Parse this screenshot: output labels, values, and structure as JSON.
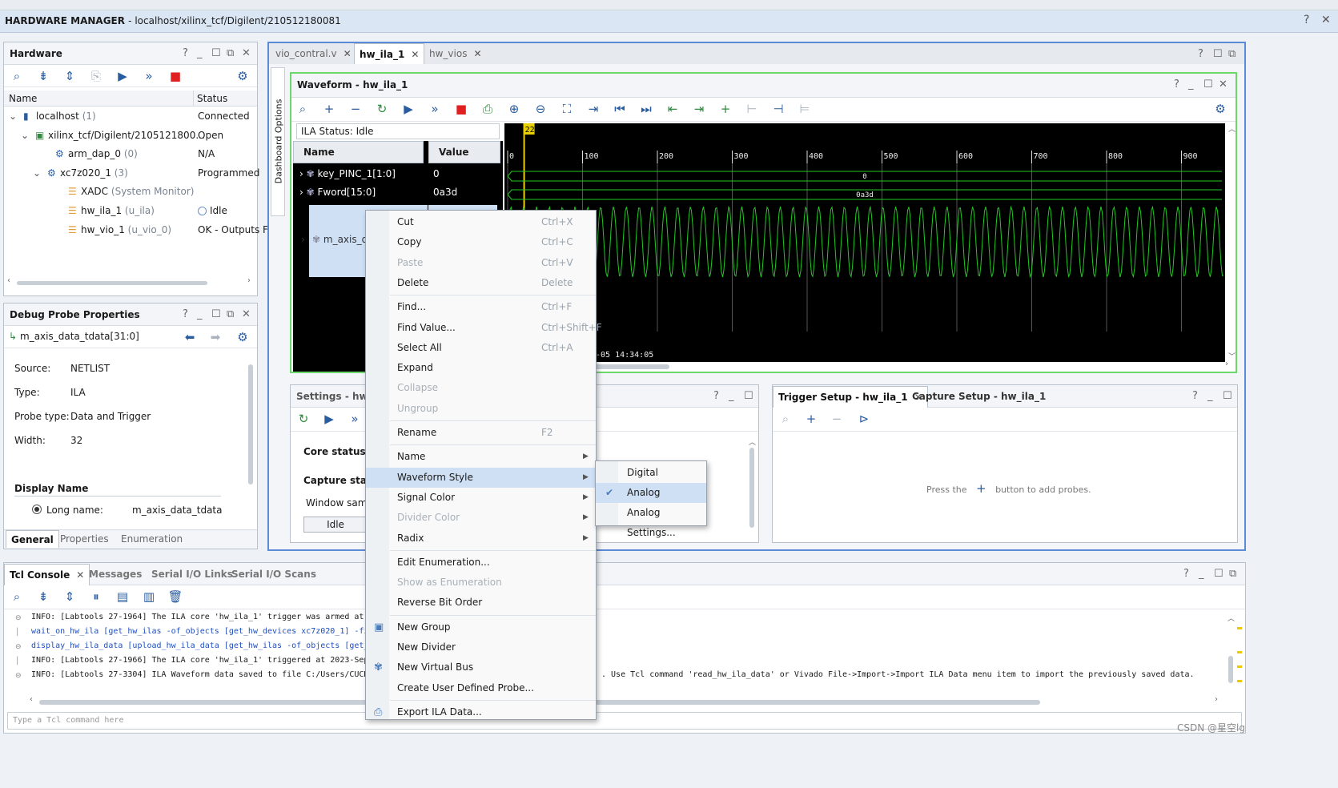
{
  "app": {
    "title": "HARDWARE MANAGER",
    "target": "- localhost/xilinx_tcf/Digilent/210512180081"
  },
  "hardware": {
    "title": "Hardware",
    "col_name": "Name",
    "col_status": "Status",
    "rows": [
      {
        "name": "localhost",
        "suffix": "(1)",
        "status": "Connected"
      },
      {
        "name": "xilinx_tcf/Digilent/2105121800...",
        "suffix": "",
        "status": "Open"
      },
      {
        "name": "arm_dap_0",
        "suffix": "(0)",
        "status": "N/A"
      },
      {
        "name": "xc7z020_1",
        "suffix": "(3)",
        "status": "Programmed"
      },
      {
        "name": "XADC",
        "suffix": "(System Monitor)",
        "status": ""
      },
      {
        "name": "hw_ila_1",
        "suffix": "(u_ila)",
        "status": "Idle"
      },
      {
        "name": "hw_vio_1",
        "suffix": "(u_vio_0)",
        "status": "OK - Outputs F"
      }
    ]
  },
  "probe_props": {
    "title": "Debug Probe Properties",
    "probe": "m_axis_data_tdata[31:0]",
    "source_lbl": "Source:",
    "source": "NETLIST",
    "type_lbl": "Type:",
    "type": "ILA",
    "ptype_lbl": "Probe type:",
    "ptype": "Data and Trigger",
    "width_lbl": "Width:",
    "width": "32",
    "display_name": "Display Name",
    "long_name_lbl": "Long name:",
    "long_name": "m_axis_data_tdata",
    "tabs": [
      "General",
      "Properties",
      "Enumeration"
    ]
  },
  "editor_tabs": [
    "vio_contral.v",
    "hw_ila_1",
    "hw_vios"
  ],
  "dashboard_options": "Dashboard Options",
  "waveform": {
    "title": "Waveform - hw_ila_1",
    "ila_status": "ILA Status:  Idle",
    "col_name": "Name",
    "col_value": "Value",
    "marker": "22",
    "signals": [
      {
        "name": "key_PINC_1[1:0]",
        "value": "0",
        "wave_text": "0"
      },
      {
        "name": "Fword[15:0]",
        "value": "0a3d",
        "wave_text": "0a3d"
      },
      {
        "name": "m_axis_da",
        "value": "",
        "wave_text": ""
      }
    ],
    "ticks": [
      "0",
      "100",
      "200",
      "300",
      "400",
      "500",
      "600",
      "700",
      "800",
      "900"
    ],
    "timestamp": "-05 14:34:05"
  },
  "settings": {
    "title": "Settings - hw_ila",
    "core_status": "Core status",
    "capture_status": "Capture status",
    "window_samp": "Window samp",
    "idle": "Idle"
  },
  "trigger": {
    "tab1": "Trigger Setup - hw_ila_1",
    "tab2": "Capture Setup - hw_ila_1",
    "press": "Press the",
    "add": "button to add probes."
  },
  "console": {
    "tabs": [
      "Tcl Console",
      "Messages",
      "Serial I/O Links",
      "Serial I/O Scans"
    ],
    "lines": [
      {
        "text": "INFO: [Labtools 27-1964] The ILA core 'hw_ila_1' trigger was armed at 2023-",
        "blue": false
      },
      {
        "text": "wait_on_hw_ila [get_hw_ilas -of_objects [get_hw_devices xc7z020_1] -filter",
        "blue": true
      },
      {
        "text": "display_hw_ila_data [upload_hw_ila_data [get_hw_ilas -of_objects [get_hw_de",
        "blue": true
      },
      {
        "text": "INFO: [Labtools 27-1966] The ILA core 'hw_ila_1' triggered at 2023-Sep-05 1",
        "blue": false
      },
      {
        "text": "INFO: [Labtools 27-3304] ILA Waveform data saved to file C:/Users/CUCHF/Des",
        "blue": false
      }
    ],
    "line_tail": ". Use Tcl command 'read_hw_ila_data' or Vivado File->Import->Import ILA Data menu item to import the previously saved data.",
    "placeholder": "Type a Tcl command here"
  },
  "context_menu": {
    "items": [
      {
        "label": "Cut",
        "shortcut": "Ctrl+X",
        "disabled": false,
        "submenu": false
      },
      {
        "label": "Copy",
        "shortcut": "Ctrl+C",
        "disabled": false,
        "submenu": false
      },
      {
        "label": "Paste",
        "shortcut": "Ctrl+V",
        "disabled": true,
        "submenu": false
      },
      {
        "label": "Delete",
        "shortcut": "Delete",
        "disabled": false,
        "submenu": false
      },
      {
        "label": "Find...",
        "shortcut": "Ctrl+F",
        "disabled": false,
        "submenu": false
      },
      {
        "label": "Find Value...",
        "shortcut": "Ctrl+Shift+F",
        "disabled": false,
        "submenu": false
      },
      {
        "label": "Select All",
        "shortcut": "Ctrl+A",
        "disabled": false,
        "submenu": false
      },
      {
        "label": "Expand",
        "shortcut": "",
        "disabled": false,
        "submenu": false
      },
      {
        "label": "Collapse",
        "shortcut": "",
        "disabled": true,
        "submenu": false
      },
      {
        "label": "Ungroup",
        "shortcut": "",
        "disabled": true,
        "submenu": false
      },
      {
        "label": "Rename",
        "shortcut": "F2",
        "disabled": false,
        "submenu": false
      },
      {
        "label": "Name",
        "shortcut": "",
        "disabled": false,
        "submenu": true
      },
      {
        "label": "Waveform Style",
        "shortcut": "",
        "disabled": false,
        "submenu": true
      },
      {
        "label": "Signal Color",
        "shortcut": "",
        "disabled": false,
        "submenu": true
      },
      {
        "label": "Divider Color",
        "shortcut": "",
        "disabled": true,
        "submenu": true
      },
      {
        "label": "Radix",
        "shortcut": "",
        "disabled": false,
        "submenu": true
      },
      {
        "label": "Edit Enumeration...",
        "shortcut": "",
        "disabled": false,
        "submenu": false
      },
      {
        "label": "Show as Enumeration",
        "shortcut": "",
        "disabled": true,
        "submenu": false
      },
      {
        "label": "Reverse Bit Order",
        "shortcut": "",
        "disabled": false,
        "submenu": false
      },
      {
        "label": "New Group",
        "shortcut": "",
        "disabled": false,
        "submenu": false
      },
      {
        "label": "New Divider",
        "shortcut": "",
        "disabled": false,
        "submenu": false
      },
      {
        "label": "New Virtual Bus",
        "shortcut": "",
        "disabled": false,
        "submenu": false
      },
      {
        "label": "Create User Defined Probe...",
        "shortcut": "",
        "disabled": false,
        "submenu": false
      },
      {
        "label": "Export ILA Data...",
        "shortcut": "",
        "disabled": false,
        "submenu": false
      }
    ],
    "submenu": [
      "Digital",
      "Analog",
      "Analog Settings..."
    ]
  },
  "watermark": "CSDN @星空lg"
}
